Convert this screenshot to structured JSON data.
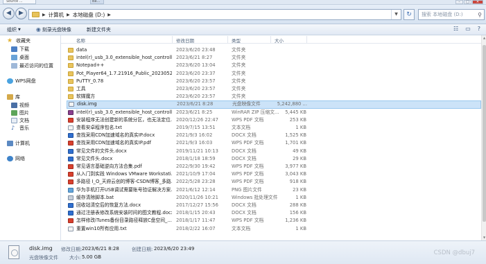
{
  "window": {
    "tabs": [
      "Source ...",
      "Ba..."
    ],
    "controls": [
      "–",
      "□",
      "✕"
    ]
  },
  "address_bar": {
    "back": "◀",
    "forward": "▶",
    "crumbs": [
      "计算机",
      "本地磁盘 (D:)"
    ],
    "search_placeholder": "搜索 本地磁盘 (D:)"
  },
  "toolbar": {
    "organize": "组织",
    "burn": "刻录光盘映像",
    "new_folder": "新建文件夹"
  },
  "nav": {
    "favorites": "收藏夹",
    "downloads": "下载",
    "desktop": "桌面",
    "recent": "最近访问的位置",
    "wps_cloud": "WPS网盘",
    "libraries": "库",
    "videos": "视频",
    "pictures": "图片",
    "documents": "文档",
    "music": "音乐",
    "computer": "计算机",
    "network": "网络"
  },
  "columns": {
    "name": "名称",
    "modified": "修改日期",
    "type": "类型",
    "size": "大小"
  },
  "files": [
    {
      "name": "data",
      "date": "2023/6/20 23:48",
      "type": "文件夹",
      "size": "",
      "kind": "folder"
    },
    {
      "name": "intel(r)_usb_3.0_extensible_host_controller...",
      "date": "2023/6/21 8:27",
      "type": "文件夹",
      "size": "",
      "kind": "folder"
    },
    {
      "name": "Notepad++",
      "date": "2023/6/20 13:04",
      "type": "文件夹",
      "size": "",
      "kind": "folder"
    },
    {
      "name": "Pot_Player64_1.7.21916_Public_20230524",
      "date": "2023/6/20 23:37",
      "type": "文件夹",
      "size": "",
      "kind": "folder"
    },
    {
      "name": "PuTTY_0.78",
      "date": "2023/6/20 23:57",
      "type": "文件夹",
      "size": "",
      "kind": "folder"
    },
    {
      "name": "工具",
      "date": "2023/6/20 23:57",
      "type": "文件夹",
      "size": "",
      "kind": "folder"
    },
    {
      "name": "软媒魔方",
      "date": "2023/6/20 23:57",
      "type": "文件夹",
      "size": "",
      "kind": "folder"
    },
    {
      "name": "disk.img",
      "date": "2023/6/21 8:28",
      "type": "光盘映像文件",
      "size": "5,242,880 ...",
      "kind": "img",
      "selected": true
    },
    {
      "name": "intel(r)_usb_3.0_extensible_host_controller...",
      "date": "2023/6/21 8:25",
      "type": "WinRAR ZIP 压缩文...",
      "size": "5,445 KB",
      "kind": "rar"
    },
    {
      "name": "安装程序无法创建新的系统分区，也无法定位...",
      "date": "2020/12/26 22:47",
      "type": "WPS PDF 文档",
      "size": "253 KB",
      "kind": "pdf"
    },
    {
      "name": "查看安卓程序包名.txt",
      "date": "2019/7/15 13:51",
      "type": "文本文档",
      "size": "1 KB",
      "kind": "txt"
    },
    {
      "name": "查找采用CDN加速域名的真实IP.docx",
      "date": "2021/9/3 16:02",
      "type": "DOCX 文档",
      "size": "1,525 KB",
      "kind": "docx"
    },
    {
      "name": "查找采用CDN加速域名的真实IP.pdf",
      "date": "2021/9/3 16:03",
      "type": "WPS PDF 文档",
      "size": "1,701 KB",
      "kind": "pdf"
    },
    {
      "name": "常见文件的文件头.docx",
      "date": "2019/11/21 10:13",
      "type": "DOCX 文档",
      "size": "49 KB",
      "kind": "docx"
    },
    {
      "name": "常见文件头.docx",
      "date": "2018/1/18 18:59",
      "type": "DOCX 文档",
      "size": "29 KB",
      "kind": "docx"
    },
    {
      "name": "常见语言基础逆向方法合集.pdf",
      "date": "2022/9/30 19:42",
      "type": "WPS PDF 文档",
      "size": "3,977 KB",
      "kind": "pdf"
    },
    {
      "name": "从入门到实践 Windows VMware Workstati...",
      "date": "2021/10/9 17:04",
      "type": "WPS PDF 文档",
      "size": "3,043 KB",
      "kind": "pdf"
    },
    {
      "name": "多路径 I_O_天府云创的博客-CSDN博客_多路...",
      "date": "2022/5/28 23:28",
      "type": "WPS PDF 文档",
      "size": "918 KB",
      "kind": "pdf"
    },
    {
      "name": "华为手机打开USB调试需要账号验证解决方案...",
      "date": "2021/6/12 12:14",
      "type": "PNG 图片文件",
      "size": "23 KB",
      "kind": "png"
    },
    {
      "name": "缓存清除脚本.bat",
      "date": "2020/11/26 10:21",
      "type": "Windows 批处理文件",
      "size": "1 KB",
      "kind": "bat"
    },
    {
      "name": "回收站清空后的恢复方法.docx",
      "date": "2017/12/27 15:56",
      "type": "DOCX 文档",
      "size": "288 KB",
      "kind": "docx"
    },
    {
      "name": "通过注册表修改系统安装时间的图文教程.docx",
      "date": "2018/1/15 20:43",
      "type": "DOCX 文档",
      "size": "156 KB",
      "kind": "docx"
    },
    {
      "name": "怎样修改iTunes备份目录路径释放C盘空间_...",
      "date": "2018/1/17 11:47",
      "type": "WPS PDF 文档",
      "size": "1,236 KB",
      "kind": "pdf"
    },
    {
      "name": "重置win10所有应用.txt",
      "date": "2018/2/22 16:07",
      "type": "文本文档",
      "size": "1 KB",
      "kind": "txt"
    }
  ],
  "details": {
    "filename": "disk.img",
    "filetype": "光盘映像文件",
    "modified_label": "修改日期:",
    "modified_value": "2023/6/21 8:28",
    "created_label": "创建日期:",
    "created_value": "2023/6/20 23:49",
    "size_label": "大小:",
    "size_value": "5.00 GB"
  },
  "watermark": "CSDN @dbuj7"
}
